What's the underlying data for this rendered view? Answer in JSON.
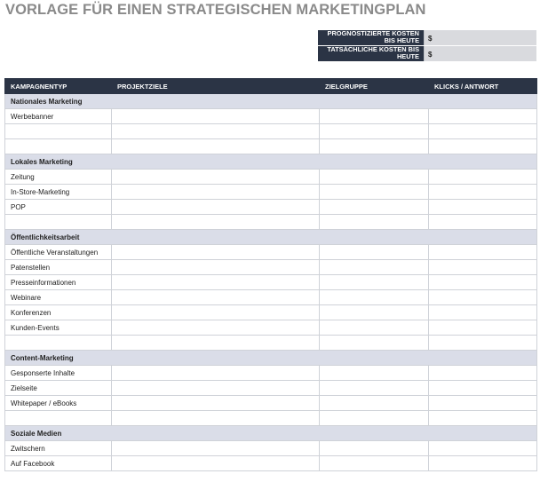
{
  "title": "VORLAGE FÜR EINEN STRATEGISCHEN MARKETINGPLAN",
  "costs": [
    {
      "label": "PROGNOSTIZIERTE KOSTEN BIS HEUTE",
      "currency": "$"
    },
    {
      "label": "TATSÄCHLICHE KOSTEN BIS HEUTE",
      "currency": "$"
    }
  ],
  "table": {
    "headers": [
      "KAMPAGNENTYP",
      "PROJEKTZIELE",
      "ZIELGRUPPE",
      "KLICKS / ANTWORT"
    ],
    "rows": [
      {
        "section": true,
        "label": "Nationales Marketing"
      },
      {
        "label": "Werbebanner"
      },
      {
        "label": ""
      },
      {
        "label": ""
      },
      {
        "section": true,
        "label": "Lokales Marketing"
      },
      {
        "label": "Zeitung"
      },
      {
        "label": "In-Store-Marketing"
      },
      {
        "label": "POP"
      },
      {
        "label": ""
      },
      {
        "section": true,
        "label": "Öffentlichkeitsarbeit"
      },
      {
        "label": "Öffentliche Veranstaltungen"
      },
      {
        "label": "Patenstellen"
      },
      {
        "label": "Presseinformationen"
      },
      {
        "label": "Webinare"
      },
      {
        "label": "Konferenzen"
      },
      {
        "label": "Kunden-Events"
      },
      {
        "label": ""
      },
      {
        "section": true,
        "label": "Content-Marketing"
      },
      {
        "label": "Gesponserte Inhalte"
      },
      {
        "label": "Zielseite"
      },
      {
        "label": "Whitepaper / eBooks"
      },
      {
        "label": ""
      },
      {
        "section": true,
        "label": "Soziale Medien"
      },
      {
        "label": "Zwitschern"
      },
      {
        "label": "Auf Facebook"
      }
    ]
  }
}
